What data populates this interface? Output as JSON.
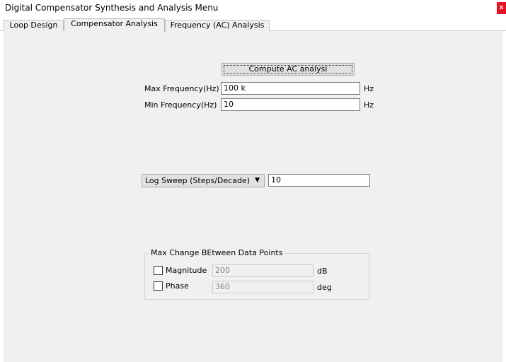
{
  "window": {
    "title": "Digital Compensator Synthesis and Analysis Menu",
    "close_label": "x"
  },
  "tabs": [
    {
      "label": "Loop Design",
      "active": false
    },
    {
      "label": "Compensator Analysis",
      "active": true
    },
    {
      "label": "Frequency (AC) Analysis",
      "active": false
    }
  ],
  "panel": {
    "compute_button_label": "Compute AC analysi",
    "max_frequency": {
      "label": "Max Frequency(Hz)",
      "value": "100 k",
      "unit": "Hz"
    },
    "min_frequency": {
      "label": "Min Frequency(Hz)",
      "value": "10",
      "unit": "Hz"
    },
    "sweep": {
      "selected": "Log Sweep (Steps/Decade)",
      "value": "10",
      "caret_icon": "dropdown-arrow-icon"
    },
    "max_change_group": {
      "title": "Max Change BEtween Data Points",
      "magnitude": {
        "label": "Magnitude",
        "checked": false,
        "value": "200",
        "unit": "dB"
      },
      "phase": {
        "label": "Phase",
        "checked": false,
        "value": "360",
        "unit": "deg"
      }
    }
  }
}
